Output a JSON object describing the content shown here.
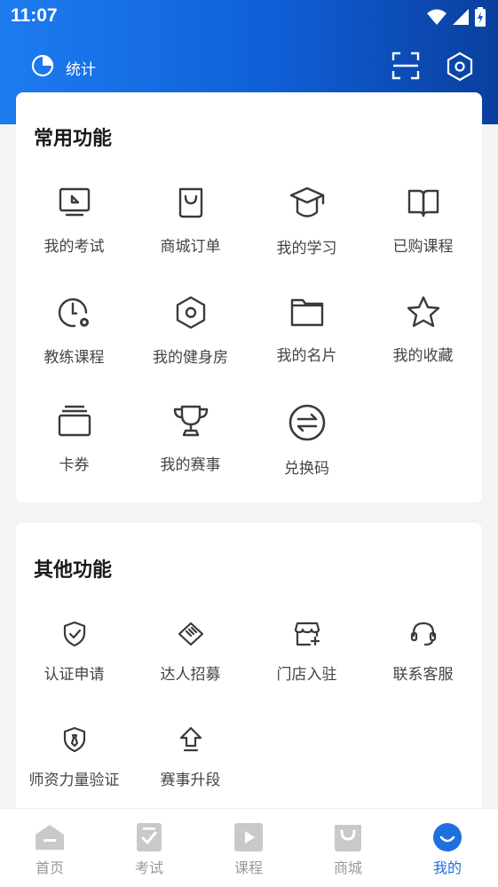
{
  "status_bar": {
    "time": "11:07"
  },
  "toolbar": {
    "stats_label": "统计"
  },
  "common_functions": {
    "title": "常用功能",
    "items": [
      {
        "label": "我的考试",
        "icon": "exam-icon"
      },
      {
        "label": "商城订单",
        "icon": "shopping-bag-icon"
      },
      {
        "label": "我的学习",
        "icon": "graduation-cap-icon"
      },
      {
        "label": "已购课程",
        "icon": "book-icon"
      },
      {
        "label": "教练课程",
        "icon": "clock-gear-icon"
      },
      {
        "label": "我的健身房",
        "icon": "hexagon-icon"
      },
      {
        "label": "我的名片",
        "icon": "folder-icon"
      },
      {
        "label": "我的收藏",
        "icon": "star-icon"
      },
      {
        "label": "卡券",
        "icon": "card-stack-icon"
      },
      {
        "label": "我的赛事",
        "icon": "trophy-icon"
      },
      {
        "label": "兑换码",
        "icon": "exchange-icon"
      }
    ]
  },
  "other_functions": {
    "title": "其他功能",
    "items": [
      {
        "label": "认证申请",
        "icon": "shield-check-icon"
      },
      {
        "label": "达人招募",
        "icon": "handshake-icon"
      },
      {
        "label": "门店入驻",
        "icon": "store-add-icon"
      },
      {
        "label": "联系客服",
        "icon": "headset-icon"
      },
      {
        "label": "师资力量验证",
        "icon": "shield-tie-icon"
      },
      {
        "label": "赛事升段",
        "icon": "arrow-up-icon"
      }
    ]
  },
  "tabbar": {
    "tabs": [
      {
        "label": "首页",
        "active": false
      },
      {
        "label": "考试",
        "active": false
      },
      {
        "label": "课程",
        "active": false
      },
      {
        "label": "商城",
        "active": false
      },
      {
        "label": "我的",
        "active": true
      }
    ]
  },
  "colors": {
    "accent": "#1f6fe0",
    "header_start": "#1e7cf0",
    "header_end": "#0a3f9e",
    "icon_stroke": "#3a3a3a",
    "tab_inactive": "#c4c4c4"
  }
}
